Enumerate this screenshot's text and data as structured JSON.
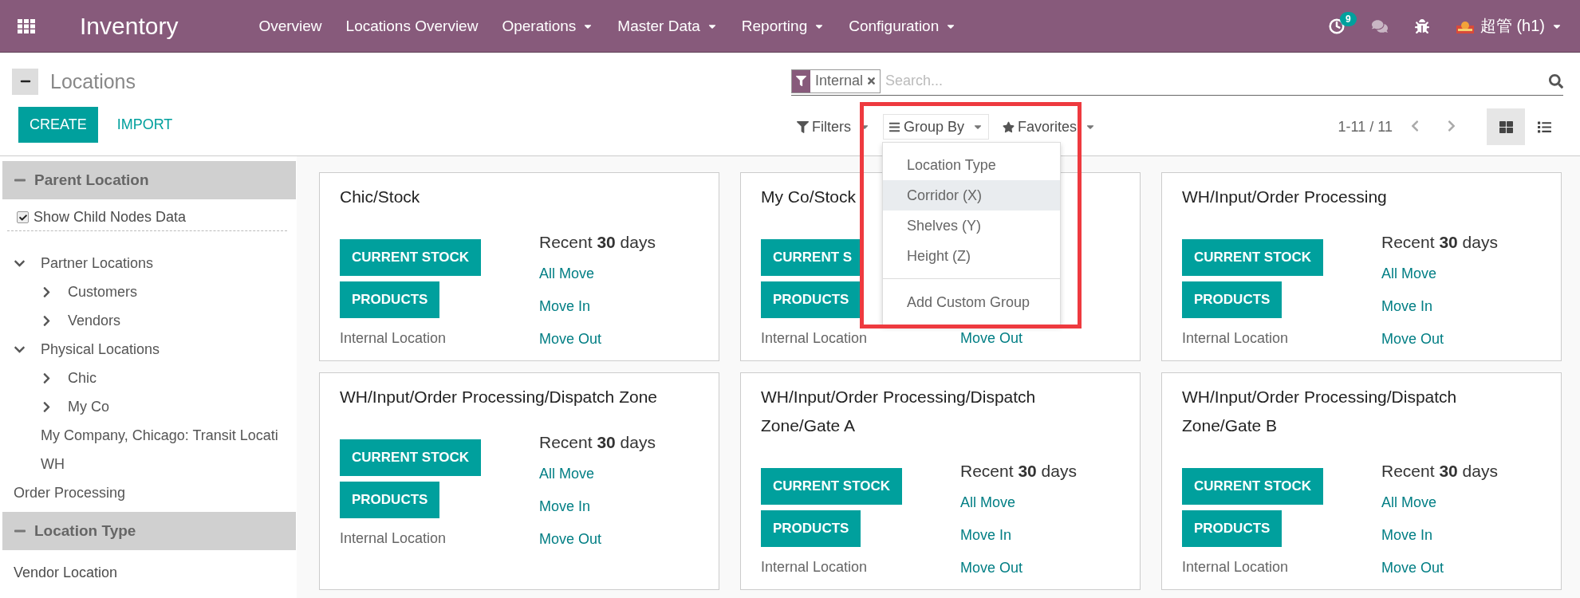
{
  "navbar": {
    "app_name": "Inventory",
    "menu": [
      {
        "label": "Overview",
        "dropdown": false
      },
      {
        "label": "Locations Overview",
        "dropdown": false
      },
      {
        "label": "Operations",
        "dropdown": true
      },
      {
        "label": "Master Data",
        "dropdown": true
      },
      {
        "label": "Reporting",
        "dropdown": true
      },
      {
        "label": "Configuration",
        "dropdown": true
      }
    ],
    "activity_count": "9",
    "user": "超管 (h1)"
  },
  "control_panel": {
    "breadcrumb": "Locations",
    "buttons": [
      {
        "label": "CREATE",
        "kind": "primary"
      },
      {
        "label": "IMPORT",
        "kind": "link"
      }
    ],
    "search": {
      "facets": [
        {
          "label": "Internal"
        }
      ],
      "placeholder": "Search..."
    },
    "search_options": [
      {
        "kind": "filters",
        "label": "Filters",
        "open": false
      },
      {
        "kind": "groupby",
        "label": "Group By",
        "open": true
      },
      {
        "kind": "favorites",
        "label": "Favorites",
        "open": false
      }
    ],
    "pager": "1-11 / 11",
    "views": [
      {
        "kind": "kanban",
        "selected": true
      },
      {
        "kind": "list",
        "selected": false
      }
    ]
  },
  "group_by_menu": {
    "items": [
      {
        "label": "Location Type",
        "highlighted": false
      },
      {
        "label": "Corridor (X)",
        "highlighted": true
      },
      {
        "label": "Shelves (Y)",
        "highlighted": false
      },
      {
        "label": "Height (Z)",
        "highlighted": false
      }
    ],
    "custom": "Add Custom Group"
  },
  "sidebar": {
    "parent_section": {
      "title": "Parent Location",
      "checkbox": {
        "label": "Show Child Nodes Data",
        "checked": true
      },
      "tree": [
        {
          "label": "Partner Locations",
          "kind": "node",
          "expanded": true,
          "children": [
            {
              "label": "Customers",
              "kind": "node",
              "expanded": false
            },
            {
              "label": "Vendors",
              "kind": "node",
              "expanded": false
            }
          ]
        },
        {
          "label": "Physical Locations",
          "kind": "node",
          "expanded": true,
          "children": [
            {
              "label": "Chic",
              "kind": "node",
              "expanded": false
            },
            {
              "label": "My Co",
              "kind": "node",
              "expanded": false
            },
            {
              "label": "My Company, Chicago: Transit Locati",
              "kind": "leaf"
            },
            {
              "label": "WH",
              "kind": "leaf"
            }
          ]
        },
        {
          "label": "Order Processing",
          "kind": "leaf"
        }
      ]
    },
    "type_section": {
      "title": "Location Type",
      "items": [
        "Vendor Location"
      ]
    }
  },
  "cards": [
    {
      "title": "Chic/Stock",
      "buttons": [
        "CURRENT STOCK",
        "PRODUCTS"
      ],
      "type": "Internal Location",
      "recent": "Recent **30** days",
      "links": [
        "All Move",
        "Move In",
        "Move Out"
      ]
    },
    {
      "title": "My Co/Stock",
      "buttons": [
        "CURRENT S",
        "PRODUCTS"
      ],
      "type": "Internal Location",
      "links": [
        "Move Out"
      ]
    },
    {
      "title": "WH/Input/Order Processing",
      "buttons": [
        "CURRENT STOCK",
        "PRODUCTS"
      ],
      "type": "Internal Location",
      "recent": "Recent **30** days",
      "links": [
        "All Move",
        "Move In",
        "Move Out"
      ]
    },
    {
      "title": "WH/Input/Order Processing/Dispatch Zone",
      "buttons": [
        "CURRENT STOCK",
        "PRODUCTS"
      ],
      "type": "Internal Location",
      "recent": "Recent **30** days",
      "links": [
        "All Move",
        "Move In",
        "Move Out"
      ]
    },
    {
      "title": "WH/Input/Order Processing/Dispatch Zone/Gate A",
      "buttons": [
        "CURRENT STOCK",
        "PRODUCTS"
      ],
      "type": "Internal Location",
      "recent": "Recent **30** days",
      "links": [
        "All Move",
        "Move In",
        "Move Out"
      ]
    },
    {
      "title": "WH/Input/Order Processing/Dispatch Zone/Gate B",
      "buttons": [
        "CURRENT STOCK",
        "PRODUCTS"
      ],
      "type": "Internal Location",
      "recent": "Recent **30** days",
      "links": [
        "All Move",
        "Move In",
        "Move Out"
      ]
    }
  ]
}
